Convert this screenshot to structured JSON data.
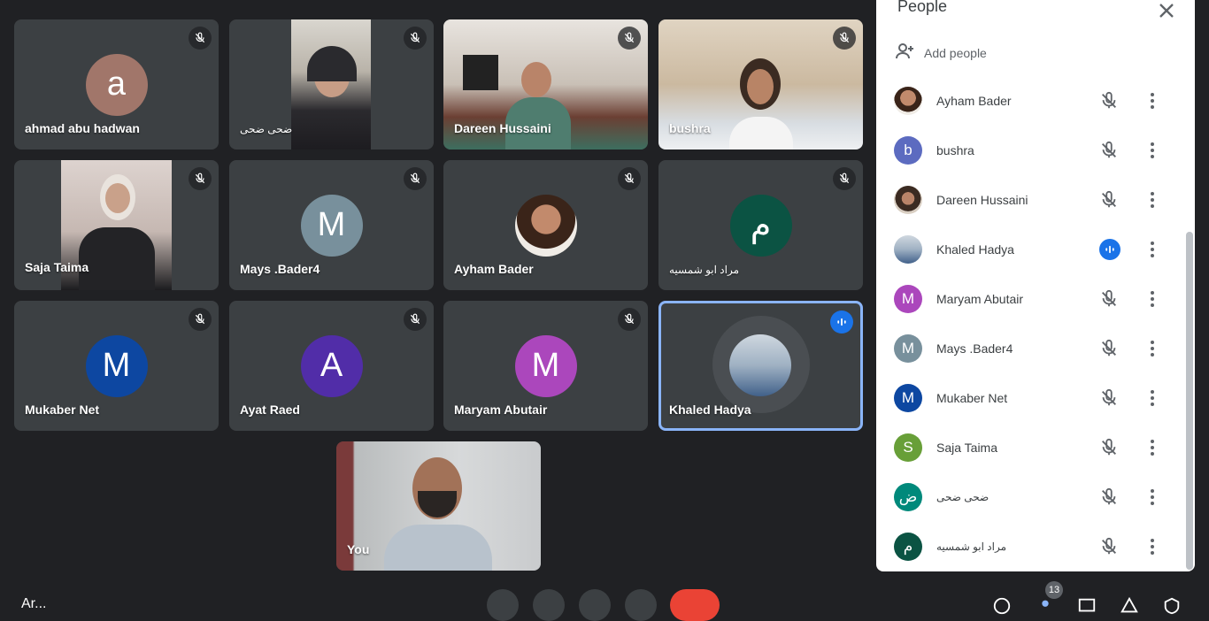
{
  "tiles": [
    {
      "name": "ahmad abu hadwan",
      "avatar": "a",
      "color": "#a1766a",
      "kind": "avatar"
    },
    {
      "name": "ضحى ضحى",
      "kind": "photo"
    },
    {
      "name": "Dareen Hussaini",
      "kind": "photo"
    },
    {
      "name": "bushra",
      "kind": "photo"
    },
    {
      "name": "Saja Taima",
      "kind": "photo"
    },
    {
      "name": "Mays .Bader4",
      "avatar": "M",
      "color": "#78909c",
      "kind": "avatar"
    },
    {
      "name": "Ayham Bader",
      "kind": "photo"
    },
    {
      "name": "مراد ابو شمسيه",
      "avatar": "م",
      "color": "#0b5343",
      "kind": "avatar"
    },
    {
      "name": "Mukaber Net",
      "avatar": "M",
      "color": "#0d47a1",
      "kind": "avatar"
    },
    {
      "name": "Ayat Raed",
      "avatar": "A",
      "color": "#512da8",
      "kind": "avatar"
    },
    {
      "name": "Maryam Abutair",
      "avatar": "M",
      "color": "#ab47bc",
      "kind": "avatar"
    },
    {
      "name": "Khaled Hadya",
      "kind": "photo",
      "speaking": true
    }
  ],
  "self_tile": {
    "name": "You"
  },
  "panel": {
    "title": "People",
    "add_people": "Add people",
    "participants": [
      {
        "name": "Ayham Bader",
        "avatar": "",
        "color": "#8d5a3b",
        "status": "muted"
      },
      {
        "name": "bushra",
        "avatar": "b",
        "color": "#5c6bc0",
        "status": "muted"
      },
      {
        "name": "Dareen Hussaini",
        "avatar": "",
        "color": "#9a6a58",
        "status": "muted"
      },
      {
        "name": "Khaled Hadya",
        "avatar": "",
        "color": "#7a8fa3",
        "status": "speaking"
      },
      {
        "name": "Maryam Abutair",
        "avatar": "M",
        "color": "#ab47bc",
        "status": "muted"
      },
      {
        "name": "Mays .Bader4",
        "avatar": "M",
        "color": "#78909c",
        "status": "muted"
      },
      {
        "name": "Mukaber Net",
        "avatar": "M",
        "color": "#0d47a1",
        "status": "muted"
      },
      {
        "name": "Saja Taima",
        "avatar": "S",
        "color": "#689f38",
        "status": "muted"
      },
      {
        "name": "ضحى ضحى",
        "avatar": "ض",
        "color": "#00897b",
        "status": "muted"
      },
      {
        "name": "مراد ابو شمسيه",
        "avatar": "م",
        "color": "#0b5343",
        "status": "muted"
      }
    ]
  },
  "toolbar": {
    "meeting_code": "Ar...",
    "people_count": "13"
  },
  "icons": {
    "mic_off": "mic-off-icon",
    "more": "more-vert-icon",
    "close": "close-icon",
    "add_person": "person-add-icon",
    "speaking": "audio-levels-icon"
  }
}
